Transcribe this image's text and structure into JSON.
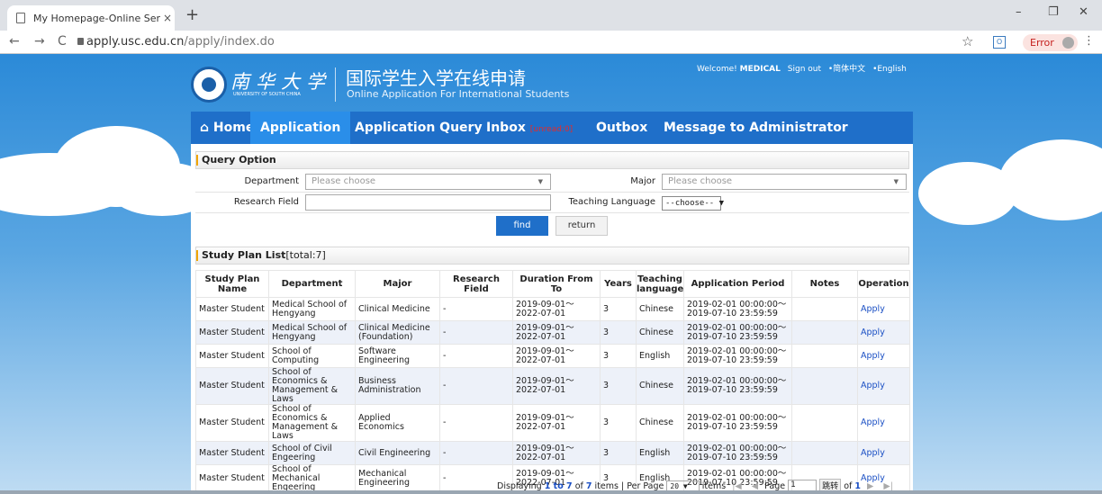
{
  "browser": {
    "tab_title": "My Homepage-Online Service",
    "tab_close": "×",
    "new_tab": "+",
    "url_main": "apply.usc.edu.cn",
    "url_path": "/apply/index.do",
    "back": "←",
    "forward": "→",
    "reload": "C",
    "star": "☆",
    "ext": "O",
    "error_label": "Error",
    "menu": "⋮",
    "minimize": "–",
    "maximize": "❐",
    "close": "✕"
  },
  "header": {
    "school_cn": "南华大学",
    "school_en": "UNIVERSITY OF SOUTH CHINA",
    "title_cn": "国际学生入学在线申请",
    "title_en": "Online Application For International Students",
    "welcome": "Welcome!",
    "user": "MEDICAL",
    "signout": "Sign out",
    "lang_cn": "•简体中文",
    "lang_en": "•English"
  },
  "menu": {
    "home": "Home",
    "home_icon": "home-icon",
    "application": "Application",
    "query": "Application Query",
    "inbox": "Inbox",
    "inbox_badge": "[unread:0]",
    "outbox": "Outbox",
    "message": "Message to Administrator"
  },
  "query": {
    "title": "Query Option",
    "department_label": "Department",
    "department_value": "Please choose",
    "major_label": "Major",
    "major_value": "Please choose",
    "research_label": "Research Field",
    "research_value": "",
    "teaching_label": "Teaching Language",
    "teaching_value": "--choose-- ▼",
    "find": "find",
    "return": "return"
  },
  "list": {
    "title": "Study Plan List",
    "total": "[total:7]",
    "headers": [
      "Study Plan Name",
      "Department",
      "Major",
      "Research Field",
      "Duration From To",
      "Years",
      "Teaching language",
      "Application Period",
      "Notes",
      "Operation"
    ],
    "rows": [
      [
        "Master Student",
        "Medical School of Hengyang",
        "Clinical Medicine",
        "-",
        "2019-09-01～2022-07-01",
        "3",
        "Chinese",
        "2019-02-01 00:00:00～ 2019-07-10 23:59:59",
        "",
        "Apply"
      ],
      [
        "Master Student",
        "Medical School of Hengyang",
        "Clinical Medicine (Foundation)",
        "-",
        "2019-09-01～2022-07-01",
        "3",
        "Chinese",
        "2019-02-01 00:00:00～ 2019-07-10 23:59:59",
        "",
        "Apply"
      ],
      [
        "Master Student",
        "School of Computing",
        "Software Engineering",
        "-",
        "2019-09-01～2022-07-01",
        "3",
        "English",
        "2019-02-01 00:00:00～ 2019-07-10 23:59:59",
        "",
        "Apply"
      ],
      [
        "Master Student",
        "School of Economics & Management & Laws",
        "Business Administration",
        "-",
        "2019-09-01～2022-07-01",
        "3",
        "Chinese",
        "2019-02-01 00:00:00～ 2019-07-10 23:59:59",
        "",
        "Apply"
      ],
      [
        "Master Student",
        "School of Economics & Management & Laws",
        "Applied Economics",
        "-",
        "2019-09-01～2022-07-01",
        "3",
        "Chinese",
        "2019-02-01 00:00:00～ 2019-07-10 23:59:59",
        "",
        "Apply"
      ],
      [
        "Master Student",
        "School of Civil Engeering",
        "Civil Engineering",
        "-",
        "2019-09-01～2022-07-01",
        "3",
        "English",
        "2019-02-01 00:00:00～ 2019-07-10 23:59:59",
        "",
        "Apply"
      ],
      [
        "Master Student",
        "School of Mechanical Engeering",
        "Mechanical Engineering",
        "-",
        "2019-09-01～2022-07-01",
        "3",
        "English",
        "2019-02-01 00:00:00～ 2019-07-10 23:59:59",
        "",
        "Apply"
      ]
    ]
  },
  "pager": {
    "displaying": "Displaying",
    "range": "1 to 7",
    "of": "of",
    "total": "7",
    "items": "items",
    "per_page": "Per Page",
    "per_page_value": "20",
    "items2": "items",
    "first": "|◀",
    "prev": "◀",
    "page_label": "Page",
    "page_value": "1",
    "go": "跳转",
    "of2": "of",
    "pages": "1",
    "next": "▶",
    "last": "▶|"
  },
  "colors": {
    "menu_blue": "#1f6fc9",
    "active_tab": "#2a8ee9",
    "link_blue": "#1a4fc4",
    "unread_red": "#e52a2a"
  }
}
